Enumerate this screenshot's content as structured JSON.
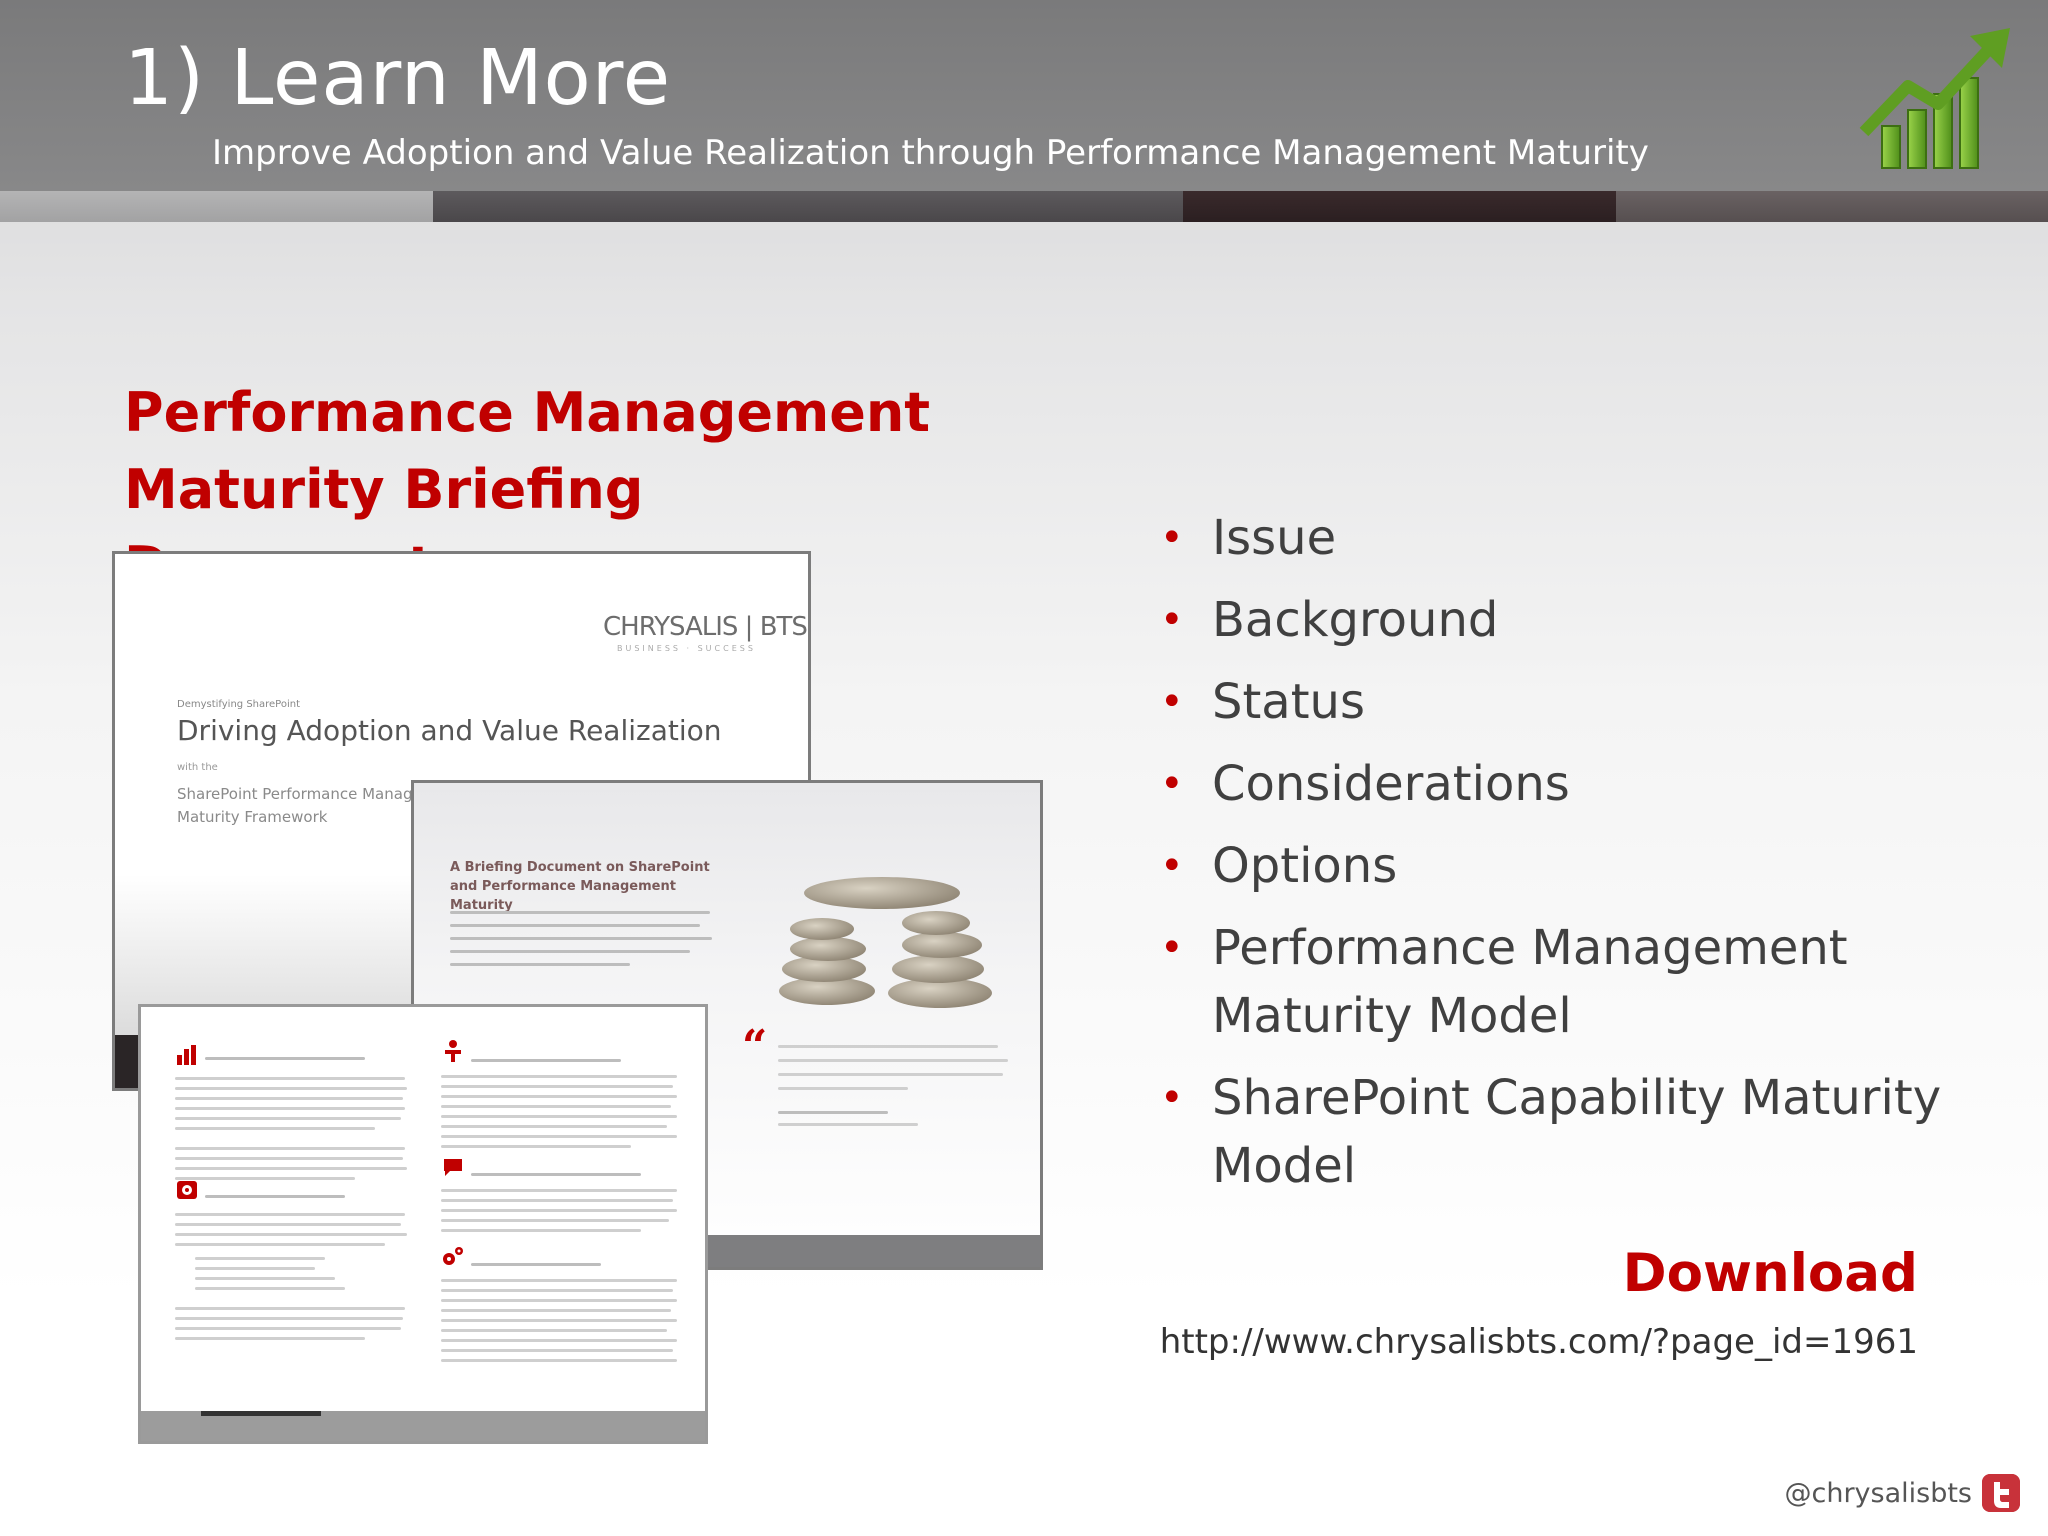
{
  "header": {
    "title": "1) Learn More",
    "subtitle": "Improve Adoption and Value Realization through Performance Management Maturity",
    "logo_icon": "bar-chart-up-arrow-icon",
    "accent_green": "#6fae2c"
  },
  "document": {
    "title_line1": "Performance Management",
    "title_line2": "Maturity Briefing Document",
    "cover": {
      "logo": "CHRYSALIS | BTS",
      "logo_sub": "BUSINESS · SUCCESS",
      "kicker": "Demystifying SharePoint",
      "title": "Driving Adoption and Value Realization",
      "with": "with the",
      "subtitle": "SharePoint Performance Management Maturity Framework"
    },
    "page2": {
      "heading": "A Briefing Document on SharePoint and Performance Management Maturity",
      "quote_mark": "“"
    }
  },
  "topics": [
    "Issue",
    "Background",
    "Status",
    "Considerations",
    "Options",
    "Performance Management Maturity Model",
    "SharePoint Capability Maturity Model"
  ],
  "download": {
    "label": "Download",
    "url": "http://www.chrysalisbts.com/?page_id=1961"
  },
  "footer": {
    "twitter_handle": "@chrysalisbts",
    "twitter_icon": "twitter-icon"
  },
  "colors": {
    "accent_red": "#c00000",
    "header_gray": "#808081"
  }
}
